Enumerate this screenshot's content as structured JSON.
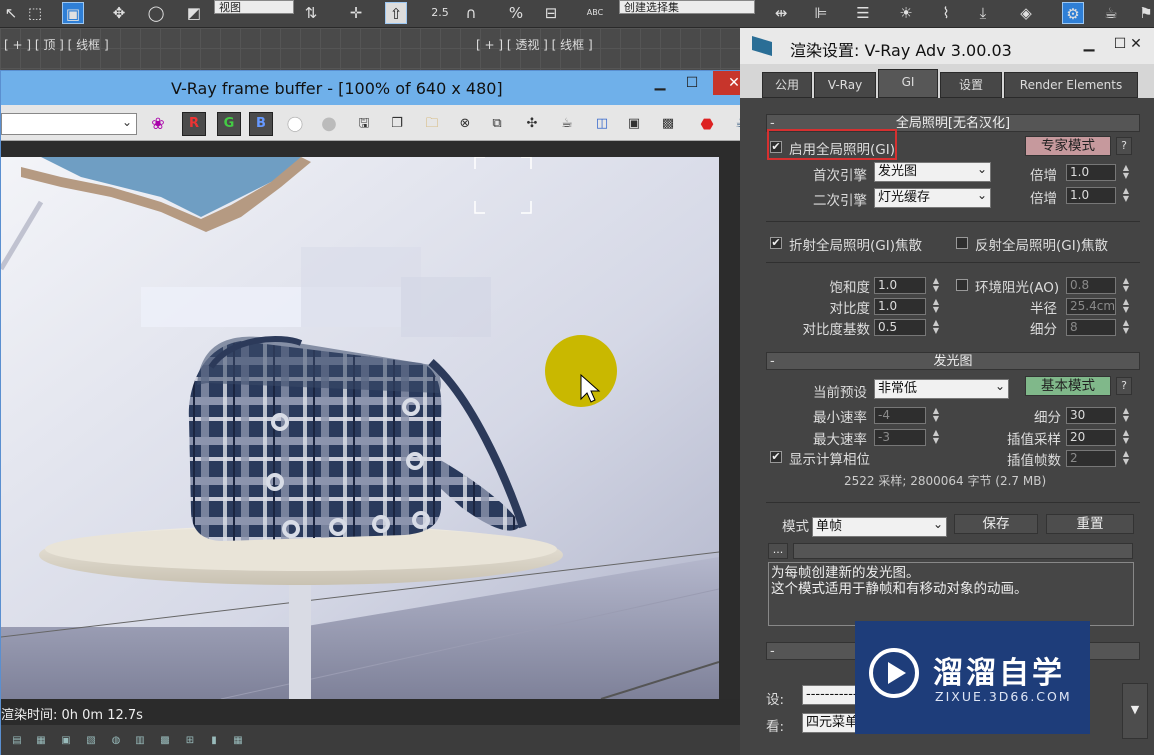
{
  "toolbar": {
    "view_dropdown": "视图",
    "selection_set_dropdown": "创建选择集",
    "spin_value": "2.5",
    "abc_label": "ABC"
  },
  "viewports": {
    "left_label": "[ + ] [ 顶 ] [ 线框 ]",
    "right_label": "[ + ] [ 透视 ] [ 线框 ]"
  },
  "frame_buffer": {
    "title": "V-Ray frame buffer - [100% of 640 x 480]",
    "channels": [
      "R",
      "G",
      "B"
    ],
    "status_text": "渲染时间:  0h  0m 12.7s",
    "bottom_icons": [
      "▤",
      "▦",
      "▣",
      "▧",
      "◍",
      "▥",
      "▩",
      "⊞",
      "▮",
      "▦"
    ]
  },
  "render_settings": {
    "title": "渲染设置: V-Ray Adv 3.00.03",
    "tabs": [
      {
        "label": "公用"
      },
      {
        "label": "V-Ray"
      },
      {
        "label": "GI"
      },
      {
        "label": "设置"
      },
      {
        "label": "Render Elements"
      }
    ],
    "gi_panel": {
      "header": "全局照明[无名汉化]",
      "enable_gi_label": "启用全局照明(GI)",
      "enable_gi_checked": true,
      "expert_mode_button": "专家模式",
      "help": "?",
      "primary_engine_label": "首次引擎",
      "primary_engine_value": "发光图",
      "secondary_engine_label": "二次引擎",
      "secondary_engine_value": "灯光缓存",
      "multiplier_label": "倍增",
      "primary_multiplier": "1.0",
      "secondary_multiplier": "1.0",
      "refractive_caustics_label": "折射全局照明(GI)焦散",
      "refractive_caustics_checked": true,
      "reflective_caustics_label": "反射全局照明(GI)焦散",
      "reflective_caustics_checked": false,
      "saturation_label": "饱和度",
      "saturation": "1.0",
      "contrast_label": "对比度",
      "contrast": "1.0",
      "contrast_base_label": "对比度基数",
      "contrast_base": "0.5",
      "ao_label": "环境阻光(AO)",
      "ao_checked": false,
      "ao_value": "0.8",
      "radius_label": "半径",
      "radius": "25.4cm",
      "subdivs_label": "细分",
      "subdivs": "8"
    },
    "irradiance_panel": {
      "header": "发光图",
      "preset_label": "当前预设",
      "preset_value": "非常低",
      "basic_mode_button": "基本模式",
      "min_rate_label": "最小速率",
      "min_rate": "-4",
      "max_rate_label": "最大速率",
      "max_rate": "-3",
      "subdivs_label": "细分",
      "subdivs": "30",
      "interp_samples_label": "插值采样",
      "interp_samples": "20",
      "interp_frames_label": "插值帧数",
      "interp_frames": "2",
      "show_calc_label": "显示计算相位",
      "show_calc_checked": true,
      "stats": "2522 采样; 2800064 字节 (2.7 MB)",
      "mode_label": "模式",
      "mode_value": "单帧",
      "save_button": "保存",
      "reset_button": "重置",
      "browse_button": "...",
      "description_line1": "为每帧创建新的发光图。",
      "description_line2": "这个模式适用于静帧和有移动对象的动画。"
    },
    "bottom": {
      "preset_label": "设:",
      "preset_value": "-----------",
      "view_label": "看:",
      "view_value": "四元菜单"
    }
  },
  "watermark": {
    "big_text": "溜溜自学",
    "small_text": "ZIXUE.3D66.COM"
  },
  "colors": {
    "highlight_box": "#d63030",
    "cursor_highlight": "#c9b800",
    "titlebar_blue": "#6fb0ea"
  }
}
